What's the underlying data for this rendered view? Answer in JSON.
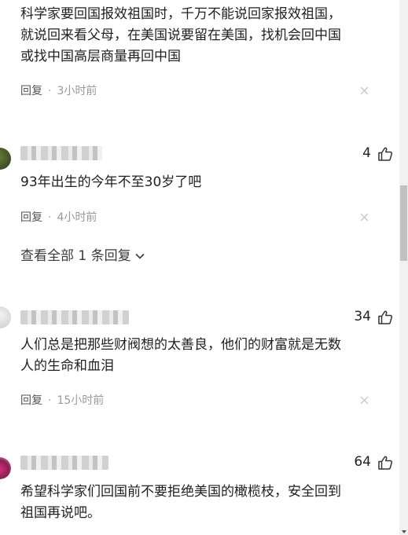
{
  "comments": [
    {
      "text": "科学家要回国报效祖国时，千万不能说回家报效祖国，就说回来看父母，在美国说要留在美国，找机会回中国或找中国高层商量再回中国",
      "reply_label": "回复",
      "time": "3小时前"
    },
    {
      "likes": "4",
      "text": "93年出生的今年不至30岁了吧",
      "reply_label": "回复",
      "time": "4小时前",
      "view_replies": "查看全部 1 条回复"
    },
    {
      "likes": "34",
      "text": "人们总是把那些财阀想的太善良，他们的财富就是无数人的生命和血泪",
      "reply_label": "回复",
      "time": "15小时前"
    },
    {
      "likes": "64",
      "text": "希望科学家们回国前不要拒绝美国的橄榄枝，安全回到祖国再说吧。"
    }
  ],
  "meta_separator": "·",
  "icons": {
    "like": "thumbs-up-icon",
    "close": "close-icon",
    "chevron": "chevron-down-icon"
  },
  "colors": {
    "text": "#1f1f1f",
    "meta": "#6e6e6e",
    "time": "#9a9a9a",
    "close": "#c8c8c8"
  }
}
